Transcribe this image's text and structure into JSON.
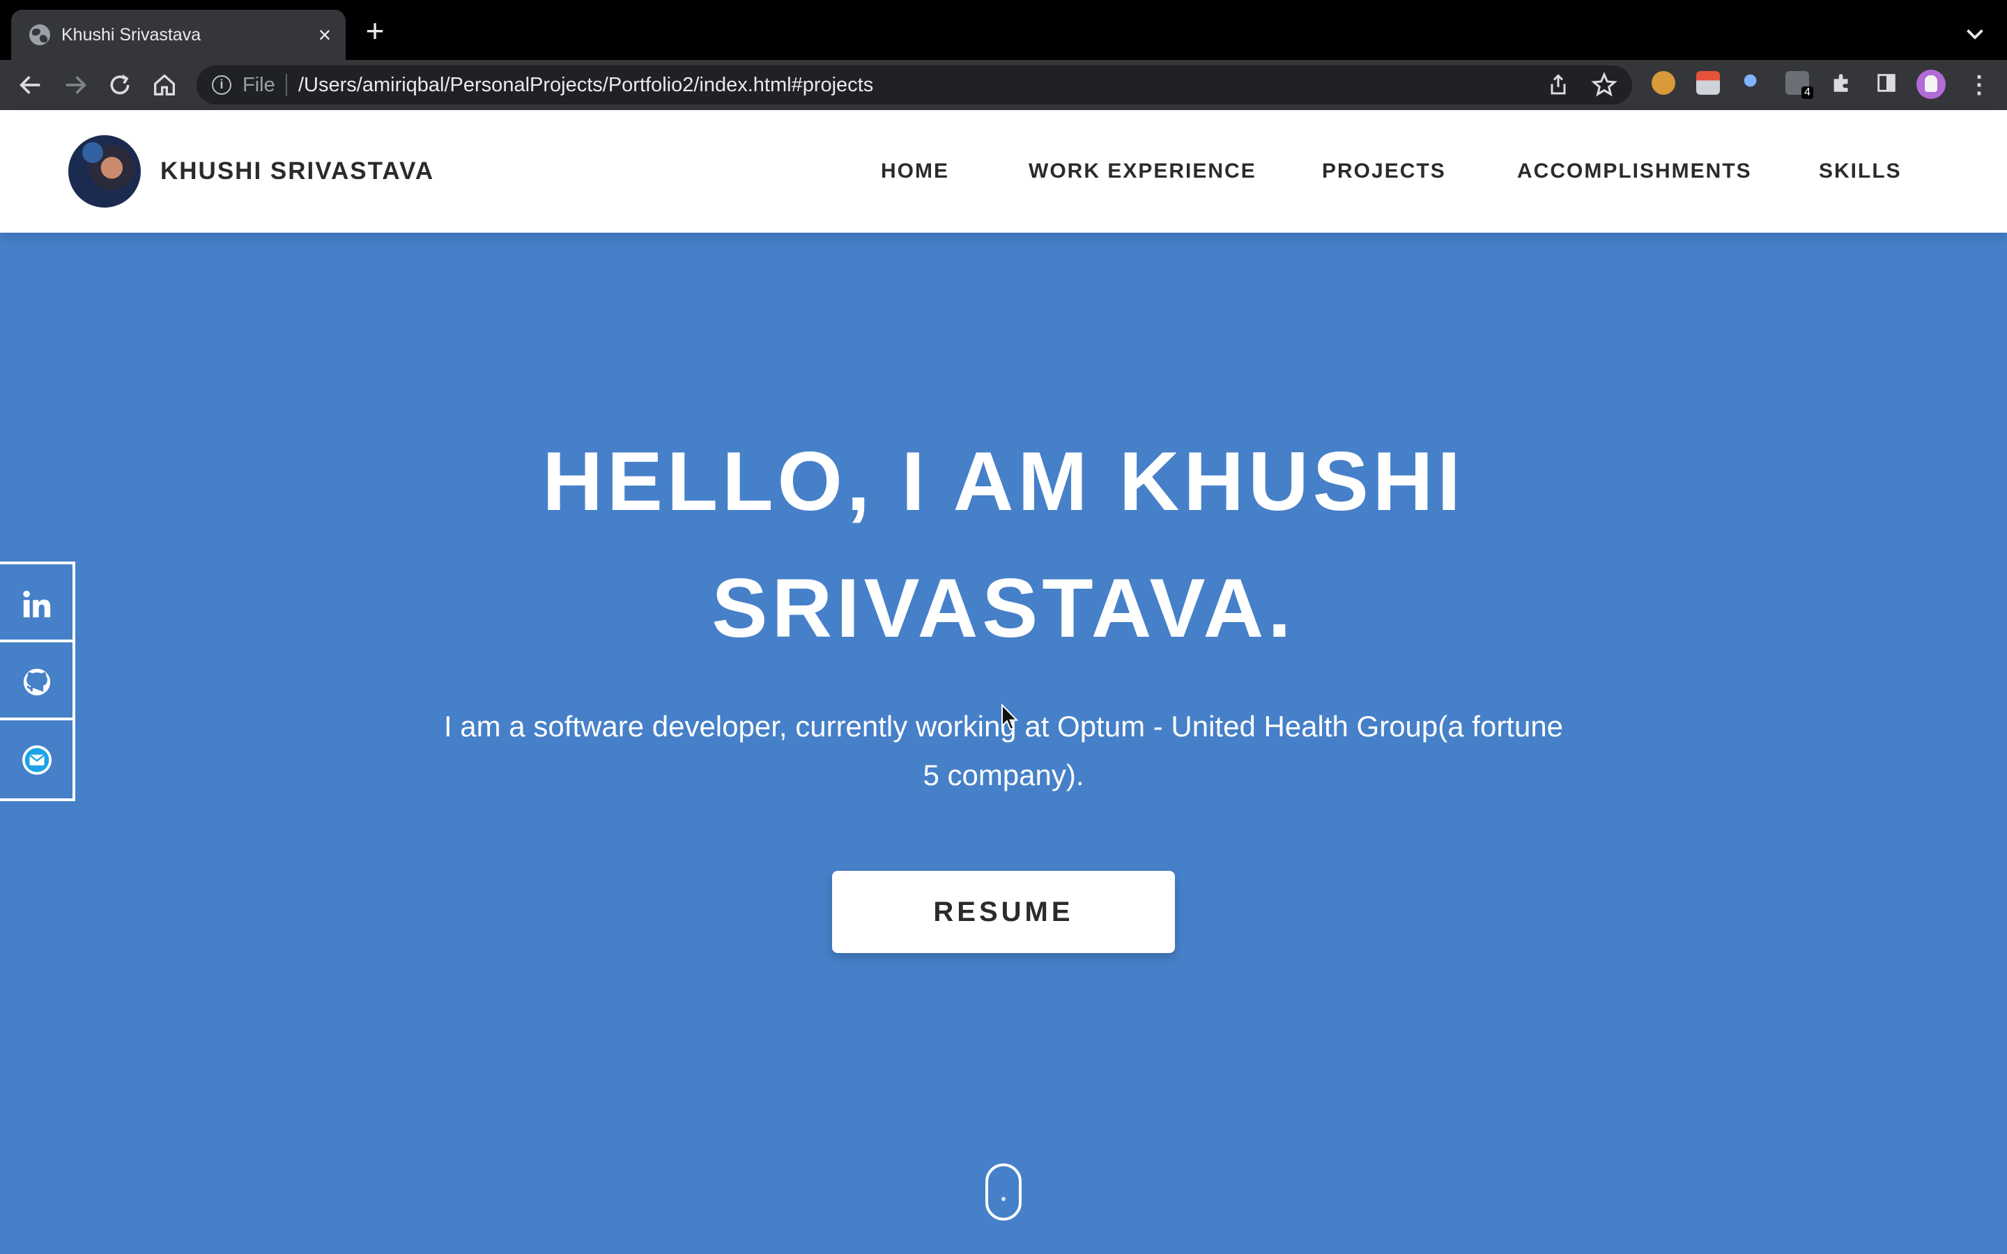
{
  "browser": {
    "tab_title": "Khushi Srivastava",
    "close_glyph": "×",
    "new_tab_glyph": "+",
    "url_scheme": "File",
    "url": "/Users/amiriqbal/PersonalProjects/Portfolio2/index.html#projects",
    "extension_badge": "4",
    "icons": [
      "globe-icon",
      "close-icon",
      "plus-icon",
      "chevron-down-icon",
      "back-arrow-icon",
      "forward-arrow-icon",
      "reload-icon",
      "home-icon",
      "info-icon",
      "share-icon",
      "star-icon",
      "puzzle-icon",
      "side-panel-icon",
      "profile-icon",
      "more-vert-icon"
    ]
  },
  "site": {
    "brand_name": "KHUSHI SRIVASTAVA",
    "nav": [
      {
        "label": "HOME"
      },
      {
        "label": "WORK EXPERIENCE"
      },
      {
        "label": "PROJECTS"
      },
      {
        "label": "ACCOMPLISHMENTS"
      },
      {
        "label": "SKILLS"
      }
    ],
    "hero": {
      "title": "HELLO, I AM KHUSHI SRIVASTAVA.",
      "subtitle": "I am a software developer, currently working at Optum - United Health Group(a fortune 5 company).",
      "button": "RESUME"
    },
    "social": [
      "linkedin-icon",
      "github-icon",
      "email-icon"
    ]
  },
  "colors": {
    "hero_bg": "#4680c8",
    "nav_text": "#2b2b2b",
    "chrome_dark": "#35363a"
  }
}
